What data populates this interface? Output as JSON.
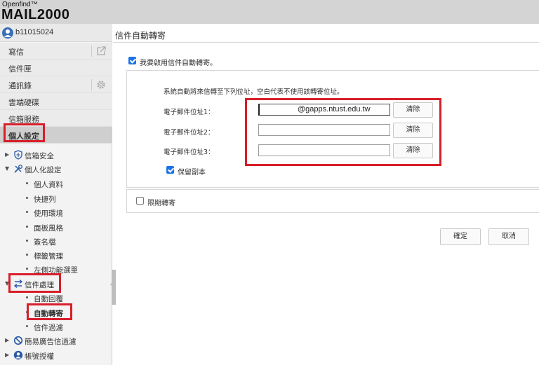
{
  "brand": {
    "top_line": "Openfind™",
    "name": "MAIL2000"
  },
  "user": {
    "name": "b11015024"
  },
  "sidebar": {
    "menu": [
      {
        "label": "寫信",
        "icon": "external-link-icon"
      },
      {
        "label": "信件匣"
      },
      {
        "label": "通訊錄",
        "icon": "gear-icon"
      },
      {
        "label": "雲端硬碟"
      },
      {
        "label": "信箱服務"
      },
      {
        "label": "個人設定",
        "active": true
      }
    ],
    "tree": [
      {
        "label": "信箱安全",
        "icon": "shield-icon",
        "expanded": false
      },
      {
        "label": "個人化設定",
        "icon": "tools-icon",
        "expanded": true,
        "children": [
          "個人資料",
          "快捷列",
          "使用環境",
          "面板風格",
          "簽名檔",
          "標籤管理",
          "左側功能選單"
        ]
      },
      {
        "label": "信件處理",
        "icon": "transfer-icon",
        "expanded": true,
        "children": [
          "自動回覆",
          "自動轉寄",
          "信件過濾"
        ]
      },
      {
        "label": "簡易廣告信過濾",
        "icon": "block-icon",
        "expanded": false
      },
      {
        "label": "帳號授權",
        "icon": "user-circle-icon",
        "expanded": false
      }
    ]
  },
  "main": {
    "title": "信件自動轉寄",
    "enable_label": "我要啟用信件自動轉寄。",
    "enable_checked": true,
    "description": "系統自動將來信轉至下列位址，空白代表不使用該轉寄位址。",
    "addresses": [
      {
        "label": "電子郵件位址1：",
        "value": "@gapps.ntust.edu.tw",
        "clear": "清除"
      },
      {
        "label": "電子郵件位址2：",
        "value": "",
        "clear": "清除"
      },
      {
        "label": "電子郵件位址3：",
        "value": "",
        "clear": "清除"
      }
    ],
    "keep_copy_label": "保留副本",
    "keep_copy_checked": true,
    "limit_label": "限期轉寄",
    "limit_checked": false,
    "confirm": "確定",
    "cancel": "取消"
  },
  "colors": {
    "highlight": "#d81e2a",
    "checkbox": "#1a73e8"
  }
}
